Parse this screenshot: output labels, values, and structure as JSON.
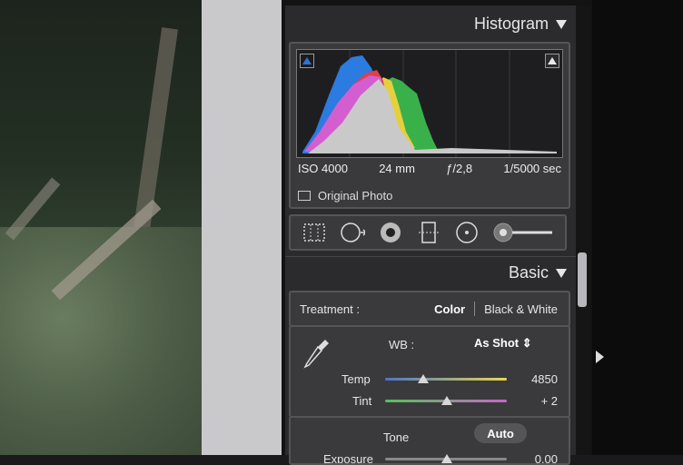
{
  "histogram": {
    "header": "Histogram",
    "iso": "ISO 4000",
    "focal": "24 mm",
    "aperture": "ƒ/2,8",
    "shutter": "1/5000 sec",
    "original_photo": "Original Photo",
    "shadow_clip_color": "#2f73d8",
    "highlight_clip_color": "#e8e8e8"
  },
  "toolstrip": {
    "tools": [
      "crop-overlay-icon",
      "spot-removal-icon",
      "red-eye-icon",
      "graduated-filter-icon",
      "radial-filter-icon",
      "adjustment-brush-icon"
    ]
  },
  "basic": {
    "header": "Basic",
    "treatment_label": "Treatment :",
    "color_option": "Color",
    "bw_option": "Black & White",
    "wb_label": "WB :",
    "wb_value": "As Shot ⇕",
    "temp_label": "Temp",
    "temp_value": "4850",
    "tint_label": "Tint",
    "tint_value": "+ 2",
    "tone_label": "Tone",
    "auto_label": "Auto",
    "exposure_label": "Exposure",
    "exposure_value": "0,00"
  },
  "colors": {
    "panel_bg": "#2b2b2d",
    "box_bg": "#3a3a3d",
    "temp_slider": [
      "#4c74c8",
      "#e8d84a"
    ],
    "tint_slider": [
      "#58c058",
      "#c468c8"
    ]
  }
}
